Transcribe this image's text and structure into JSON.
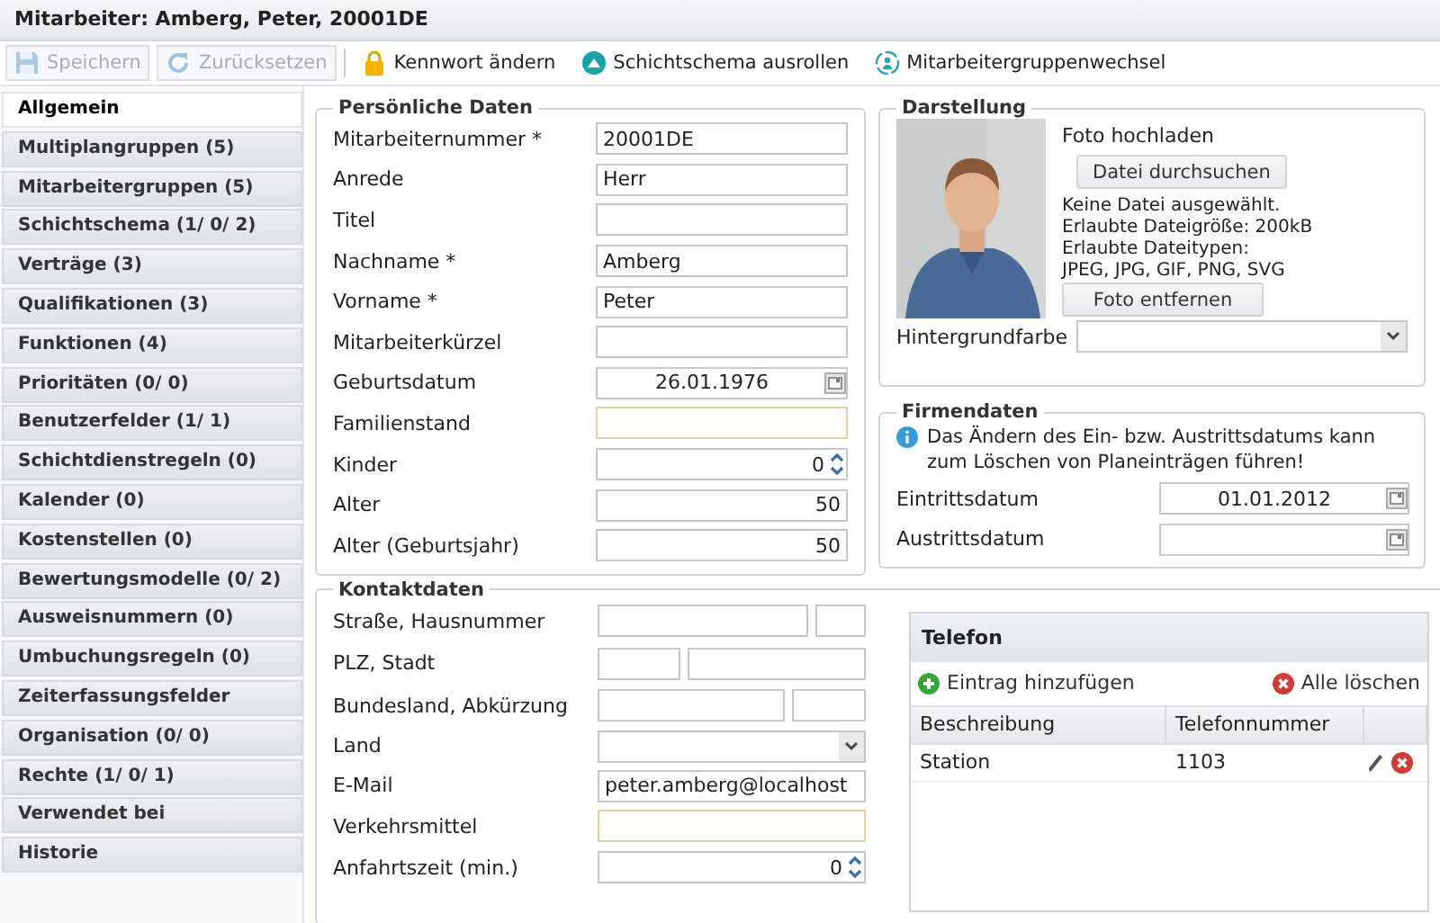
{
  "window": {
    "title": "Mitarbeiter: Amberg, Peter, 20001DE"
  },
  "toolbar": [
    {
      "kind": "save",
      "label": "Speichern",
      "disabled": true
    },
    {
      "kind": "reset",
      "label": "Zurücksetzen",
      "disabled": true
    },
    {
      "kind": "lock",
      "label": "Kennwort ändern",
      "disabled": false
    },
    {
      "kind": "rollout",
      "label": "Schichtschema ausrollen",
      "disabled": false
    },
    {
      "kind": "group-switch",
      "label": "Mitarbeitergruppenwechsel",
      "disabled": false
    }
  ],
  "sidebar": {
    "items": [
      {
        "label": "Allgemein",
        "selected": true
      },
      {
        "label": "Multiplangruppen (5)",
        "selected": false
      },
      {
        "label": "Mitarbeitergruppen (5)",
        "selected": false
      },
      {
        "label": "Schichtschema (1/ 0/ 2)",
        "selected": false
      },
      {
        "label": "Verträge (3)",
        "selected": false
      },
      {
        "label": "Qualifikationen (3)",
        "selected": false
      },
      {
        "label": "Funktionen (4)",
        "selected": false
      },
      {
        "label": "Prioritäten (0/ 0)",
        "selected": false
      },
      {
        "label": "Benutzerfelder (1/ 1)",
        "selected": false
      },
      {
        "label": "Schichtdienstregeln (0)",
        "selected": false
      },
      {
        "label": "Kalender (0)",
        "selected": false
      },
      {
        "label": "Kostenstellen (0)",
        "selected": false
      },
      {
        "label": "Bewertungsmodelle (0/ 2)",
        "selected": false
      },
      {
        "label": "Ausweisnummern (0)",
        "selected": false
      },
      {
        "label": "Umbuchungsregeln (0)",
        "selected": false
      },
      {
        "label": "Zeiterfassungsfelder",
        "selected": false
      },
      {
        "label": "Organisation (0/ 0)",
        "selected": false
      },
      {
        "label": "Rechte (1/ 0/ 1)",
        "selected": false
      },
      {
        "label": "Verwendet bei",
        "selected": false
      },
      {
        "label": "Historie",
        "selected": false
      }
    ]
  },
  "personal": {
    "title": "Persönliche Daten",
    "fields": [
      {
        "label": "Mitarbeiternummer *",
        "kind": "text",
        "value": "20001DE",
        "highlighted": false
      },
      {
        "label": "Anrede",
        "kind": "text",
        "value": "Herr",
        "highlighted": false
      },
      {
        "label": "Titel",
        "kind": "text",
        "highlighted": false
      },
      {
        "label": "Nachname *",
        "kind": "text",
        "value": "Amberg",
        "highlighted": false
      },
      {
        "label": "Vorname *",
        "kind": "text",
        "value": "Peter",
        "highlighted": false
      },
      {
        "label": "Mitarbeiterkürzel",
        "kind": "text",
        "highlighted": false
      },
      {
        "label": "Geburtsdatum",
        "kind": "date",
        "value": "26.01.1976",
        "highlighted": false
      },
      {
        "label": "Familienstand",
        "kind": "text",
        "highlighted": true
      },
      {
        "label": "Kinder",
        "kind": "spinner",
        "value": "0",
        "highlighted": false
      },
      {
        "label": "Alter",
        "kind": "number",
        "value": "50",
        "highlighted": false
      },
      {
        "label": "Alter (Geburtsjahr)",
        "kind": "number",
        "value": "50",
        "highlighted": false
      }
    ]
  },
  "display": {
    "title": "Darstellung",
    "photo": {
      "kind": "picture"
    },
    "upload_label": "Foto hochladen",
    "browse_button": "Datei durchsuchen",
    "file_info": [
      "Keine Datei ausgewählt.",
      "Erlaubte Dateigröße: 200kB",
      "Erlaubte Dateitypen:",
      "JPEG, JPG, GIF, PNG, SVG"
    ],
    "remove_button": "Foto entfernen",
    "background_color": {
      "label": "Hintergrundfarbe",
      "kind": "select",
      "highlighted": false
    }
  },
  "company": {
    "title": "Firmendaten",
    "notice": "Das Ändern des Ein- bzw. Austrittsdatums kann zum Löschen von Planeinträgen führen!",
    "fields": [
      {
        "label": "Eintrittsdatum",
        "kind": "date",
        "value": "01.01.2012",
        "highlighted": false
      },
      {
        "label": "Austrittsdatum",
        "kind": "date",
        "highlighted": false
      }
    ]
  },
  "contact": {
    "title": "Kontaktdaten",
    "fields": [
      {
        "label": "Straße, Hausnummer",
        "kind": "pair-wide-narrow",
        "highlighted": false
      },
      {
        "label": "PLZ, Stadt",
        "kind": "pair-narrow-wide",
        "highlighted": false
      },
      {
        "label": "Bundesland, Abkürzung",
        "kind": "pair-wide-narrow",
        "highlighted": false
      },
      {
        "label": "Land",
        "kind": "select",
        "highlighted": false
      },
      {
        "label": "E-Mail",
        "kind": "text",
        "value": "peter.amberg@localhost",
        "highlighted": false
      },
      {
        "label": "Verkehrsmittel",
        "kind": "text",
        "highlighted": true
      },
      {
        "label": "Anfahrtszeit (min.)",
        "kind": "spinner",
        "value": "0",
        "highlighted": false
      }
    ]
  },
  "phone": {
    "title": "Telefon",
    "add_button": "Eintrag hinzufügen",
    "clear_button": "Alle löschen",
    "columns": [
      "Beschreibung",
      "Telefonnummer"
    ],
    "rows": [
      {
        "cells": [
          "Station",
          "1103"
        ]
      }
    ]
  }
}
